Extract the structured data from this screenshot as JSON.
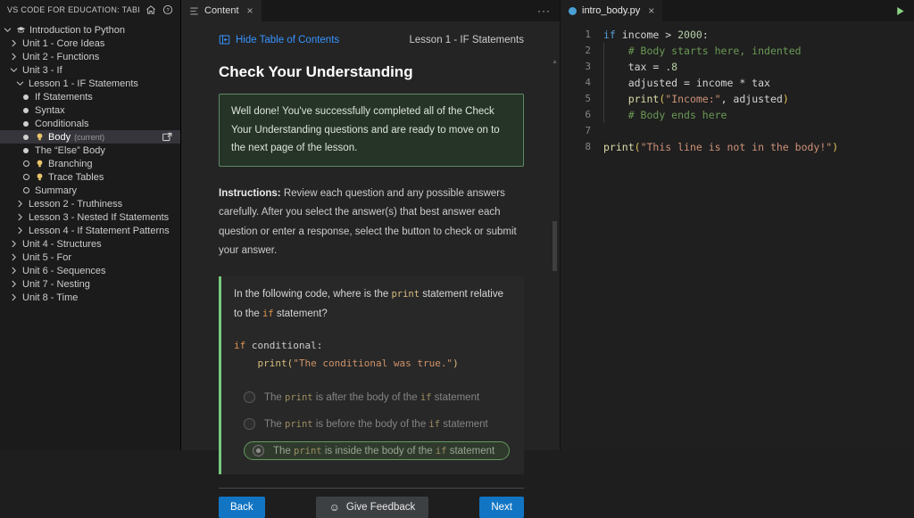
{
  "sidebar": {
    "title": "VS CODE FOR EDUCATION: TABLE OF CON...",
    "tree": [
      {
        "slug": "introduction-to-python",
        "label": "Introduction to Python",
        "level": 0,
        "twistie": "down",
        "icon": "course"
      },
      {
        "slug": "unit-1-core-ideas",
        "label": "Unit 1 - Core Ideas",
        "level": 1,
        "twistie": "right"
      },
      {
        "slug": "unit-2-functions",
        "label": "Unit 2 - Functions",
        "level": 1,
        "twistie": "right"
      },
      {
        "slug": "unit-3-if",
        "label": "Unit 3 - If",
        "level": 1,
        "twistie": "down"
      },
      {
        "slug": "lesson-1-if-statements",
        "label": "Lesson 1 - IF Statements",
        "level": 2,
        "twistie": "down"
      },
      {
        "slug": "if-statements",
        "label": "If Statements",
        "level": 3,
        "bullet": "filled"
      },
      {
        "slug": "syntax",
        "label": "Syntax",
        "level": 3,
        "bullet": "filled"
      },
      {
        "slug": "conditionals",
        "label": "Conditionals",
        "level": 3,
        "bullet": "filled"
      },
      {
        "slug": "body",
        "label": "Body",
        "suffix": "(current)",
        "level": 3,
        "bullet": "filled",
        "bulb": true,
        "selected": true,
        "action": true
      },
      {
        "slug": "the-else-body",
        "label": "The “Else” Body",
        "level": 3,
        "bullet": "filled"
      },
      {
        "slug": "branching",
        "label": "Branching",
        "level": 3,
        "bullet": "hollow",
        "bulb": true
      },
      {
        "slug": "trace-tables",
        "label": "Trace Tables",
        "level": 3,
        "bullet": "hollow",
        "bulb": true
      },
      {
        "slug": "summary",
        "label": "Summary",
        "level": 3,
        "bullet": "hollow"
      },
      {
        "slug": "lesson-2-truthiness",
        "label": "Lesson 2 - Truthiness",
        "level": 2,
        "twistie": "right"
      },
      {
        "slug": "lesson-3-nested-if-statements",
        "label": "Lesson 3 - Nested If Statements",
        "level": 2,
        "twistie": "right"
      },
      {
        "slug": "lesson-4-if-statement-patterns",
        "label": "Lesson 4 - If Statement Patterns",
        "level": 2,
        "twistie": "right"
      },
      {
        "slug": "unit-4-structures",
        "label": "Unit 4 - Structures",
        "level": 1,
        "twistie": "right"
      },
      {
        "slug": "unit-5-for",
        "label": "Unit 5 - For",
        "level": 1,
        "twistie": "right"
      },
      {
        "slug": "unit-6-sequences",
        "label": "Unit 6 - Sequences",
        "level": 1,
        "twistie": "right"
      },
      {
        "slug": "unit-7-nesting",
        "label": "Unit 7 - Nesting",
        "level": 1,
        "twistie": "right"
      },
      {
        "slug": "unit-8-time",
        "label": "Unit 8 - Time",
        "level": 1,
        "twistie": "right"
      }
    ]
  },
  "content": {
    "tab": "Content",
    "hide_toc": "Hide Table of Contents",
    "lesson": "Lesson 1 - IF Statements",
    "heading": "Check Your Understanding",
    "success": "Well done! You've successfully completed all of the Check Your Understanding questions and are ready to move on to the next page of the lesson.",
    "instructions_label": "Instructions:",
    "instructions": " Review each question and any possible answers carefully. After you select the answer(s) that best answer each question or enter a response, select the button to check or submit your answer.",
    "question": {
      "prompt": [
        [
          "t",
          "In the following code, where is the "
        ],
        [
          "c-fn",
          "print"
        ],
        [
          "t",
          " statement relative to the "
        ],
        [
          "c-kw",
          "if"
        ],
        [
          "t",
          " statement?"
        ]
      ],
      "code": [
        [
          [
            "kw",
            "if"
          ],
          [
            "pl",
            " conditional:"
          ]
        ],
        [
          [
            "pl",
            "    "
          ],
          [
            "fn",
            "print"
          ],
          [
            "br",
            "("
          ],
          [
            "str",
            "\"The conditional was true.\""
          ],
          [
            "br",
            ")"
          ]
        ]
      ],
      "options": [
        {
          "selected": false,
          "segments": [
            [
              "t",
              "The "
            ],
            [
              "c-fn",
              "print"
            ],
            [
              "t",
              " is after the body of the "
            ],
            [
              "c-kw",
              "if"
            ],
            [
              "t",
              " statement"
            ]
          ]
        },
        {
          "selected": false,
          "segments": [
            [
              "t",
              "The "
            ],
            [
              "c-fn",
              "print"
            ],
            [
              "t",
              " is before the body of the "
            ],
            [
              "c-kw",
              "if"
            ],
            [
              "t",
              " statement"
            ]
          ]
        },
        {
          "selected": true,
          "segments": [
            [
              "t",
              "The "
            ],
            [
              "c-fn",
              "print"
            ],
            [
              "t",
              " is inside the body of the "
            ],
            [
              "c-kw",
              "if"
            ],
            [
              "t",
              " statement"
            ]
          ]
        }
      ]
    },
    "buttons": {
      "back": "Back",
      "feedback": "Give Feedback",
      "next": "Next"
    }
  },
  "editor": {
    "tab": "intro_body.py",
    "lines": [
      {
        "n": 1,
        "tokens": [
          [
            "kw",
            "if"
          ],
          [
            "pl",
            " income "
          ],
          [
            "op",
            ">"
          ],
          [
            "pl",
            " "
          ],
          [
            "num",
            "2000"
          ],
          [
            "pl",
            ":"
          ]
        ]
      },
      {
        "n": 2,
        "tokens": [
          [
            "pl",
            "    "
          ],
          [
            "cm",
            "# Body starts here, indented"
          ]
        ]
      },
      {
        "n": 3,
        "tokens": [
          [
            "pl",
            "    tax = "
          ],
          [
            "num",
            ".8"
          ]
        ]
      },
      {
        "n": 4,
        "tokens": [
          [
            "pl",
            "    adjusted = income * tax"
          ]
        ]
      },
      {
        "n": 5,
        "tokens": [
          [
            "pl",
            "    "
          ],
          [
            "fn",
            "print"
          ],
          [
            "br",
            "("
          ],
          [
            "str",
            "\"Income:\""
          ],
          [
            "pl",
            ", adjusted"
          ],
          [
            "br",
            ")"
          ]
        ]
      },
      {
        "n": 6,
        "tokens": [
          [
            "pl",
            "    "
          ],
          [
            "cm",
            "# Body ends here"
          ]
        ]
      },
      {
        "n": 7,
        "tokens": []
      },
      {
        "n": 8,
        "tokens": [
          [
            "fn",
            "print"
          ],
          [
            "br",
            "("
          ],
          [
            "str",
            "\"This line is not in the body!\""
          ],
          [
            "br",
            ")"
          ]
        ]
      }
    ]
  },
  "icons": {
    "close": "×",
    "more": "···",
    "scroll_up": "▲",
    "smiley": "☺",
    "home": "home-icon",
    "help": "help-icon",
    "course": "course-icon",
    "lightbulb": "lightbulb-icon",
    "open_preview": "open-preview-icon",
    "collapse_panel": "collapse-panel-icon",
    "play": "play-icon",
    "python_file": "python-file-icon"
  },
  "colors": {
    "link_blue": "#3794ff",
    "button_blue": "#1275c4",
    "success_border": "#5d8a64",
    "success_bg": "#263427",
    "question_accent_green": "#77c97e",
    "selected_option_border": "#63975f",
    "selected_option_bg": "#2f3a2d",
    "run_green": "#8ad385",
    "bulb_yellow": "#e9c46a",
    "keyword_blue": "#569cd6",
    "comment_green": "#6a9955",
    "string_orange": "#ce9178",
    "function_gold": "#dcdcaa",
    "number_green": "#b5cea8",
    "bracket_gold": "#e2c15c"
  }
}
